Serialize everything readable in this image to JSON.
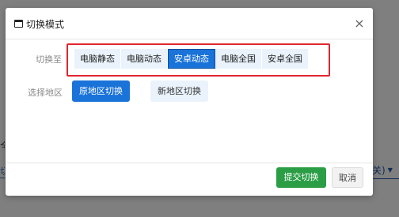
{
  "background": {
    "left_fragment_a": "全",
    "left_fragment_b": "切",
    "right_fragment": "关)"
  },
  "modal": {
    "title": "切换模式",
    "close_glyph": "×",
    "switch_label": "切换至",
    "modes": [
      "电脑静态",
      "电脑动态",
      "安卓动态",
      "电脑全国",
      "安卓全国"
    ],
    "active_mode": "安卓动态",
    "region_label": "选择地区",
    "region_buttons": [
      "原地区切换",
      "新地区切换"
    ],
    "active_region": "原地区切换",
    "submit_label": "提交切换",
    "cancel_label": "取消"
  },
  "colors": {
    "primary": "#1a73d9",
    "success": "#2a9d45",
    "highlight_frame": "#e0262f"
  }
}
